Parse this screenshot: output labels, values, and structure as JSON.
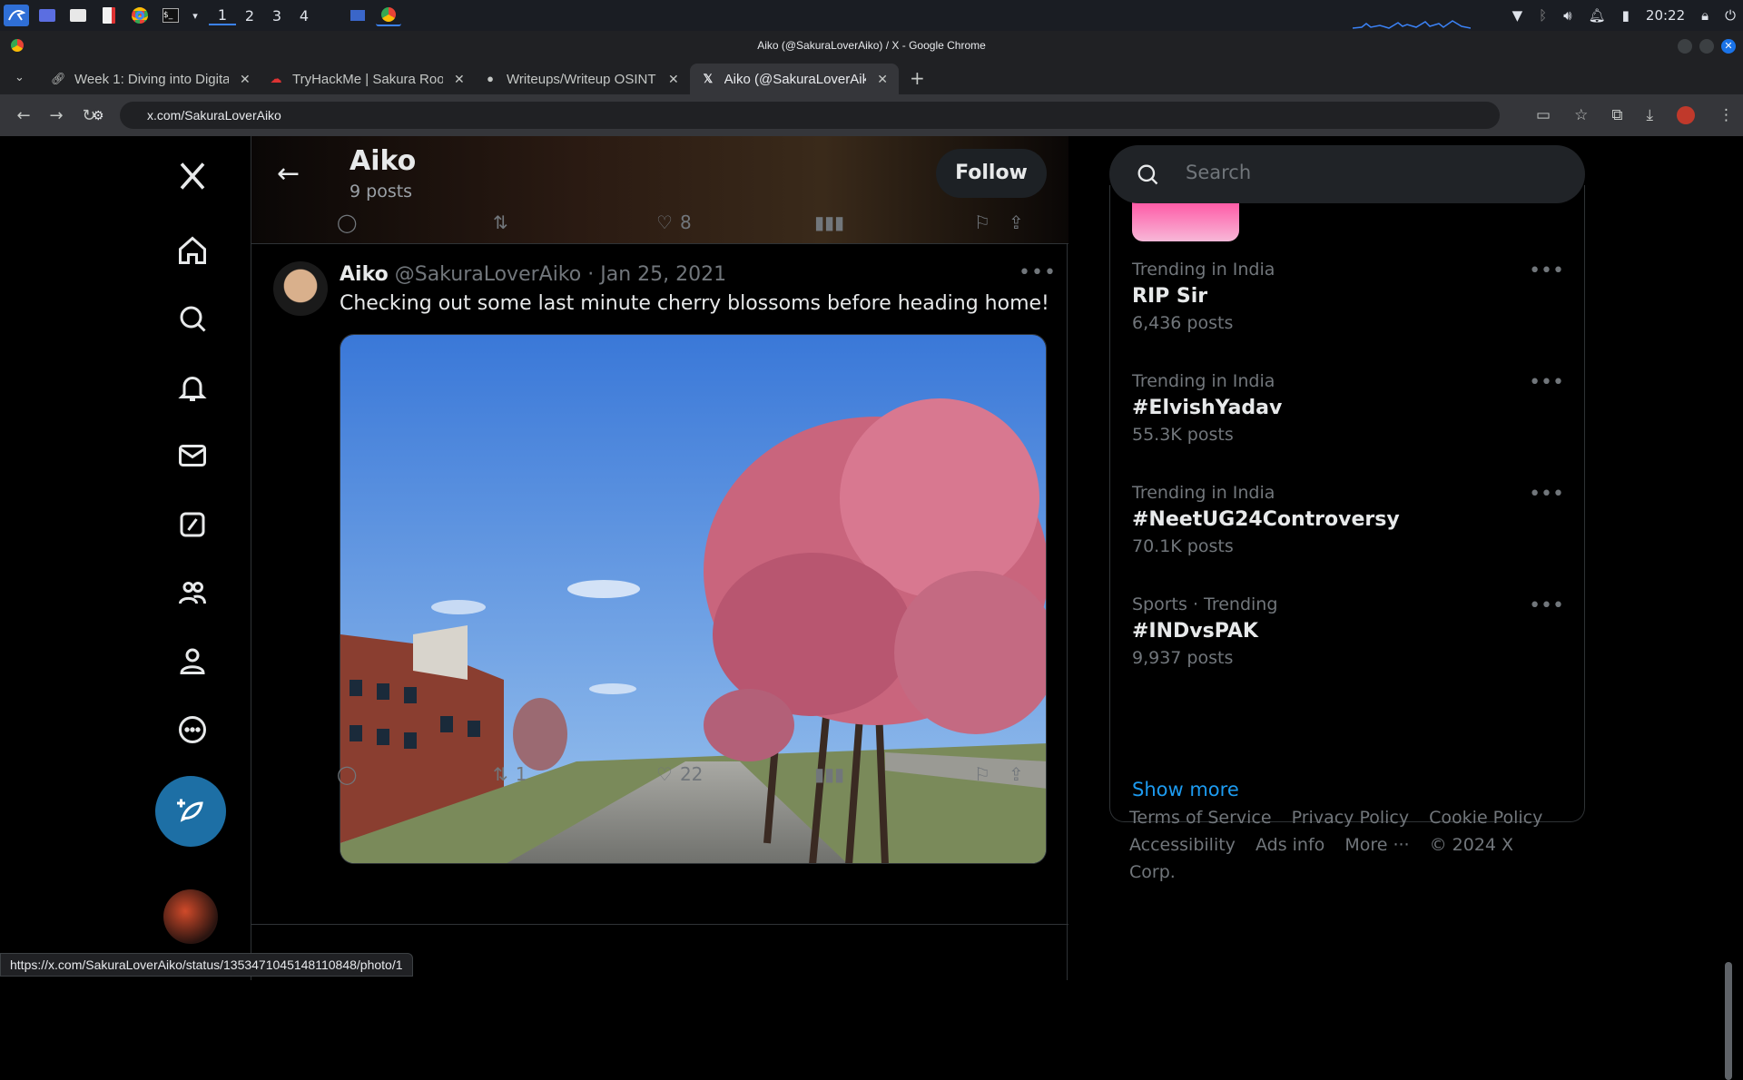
{
  "taskbar": {
    "workspaces": [
      "1",
      "2",
      "3",
      "4"
    ],
    "clock": "20:22"
  },
  "window": {
    "title": "Aiko (@SakuraLoverAiko) / X - Google Chrome"
  },
  "tabs": [
    {
      "label": "Week 1: Diving into Digita",
      "icon": "link-icon"
    },
    {
      "label": "TryHackMe | Sakura Room",
      "icon": "tryhackme-icon"
    },
    {
      "label": "Writeups/Writeup OSINT",
      "icon": "github-icon"
    },
    {
      "label": "Aiko (@SakuraLoverAiko)",
      "icon": "x-logo-icon"
    }
  ],
  "address": {
    "url": "x.com/SakuraLoverAiko"
  },
  "profile_header": {
    "name": "Aiko",
    "posts_count": "9 posts",
    "follow_label": "Follow"
  },
  "prev_tweet": {
    "likes": "8"
  },
  "tweet": {
    "name": "Aiko",
    "handle": "@SakuraLoverAiko",
    "separator": "·",
    "date": "Jan 25, 2021",
    "text": "Checking out some last minute cherry blossoms before heading home!",
    "retweets": "1",
    "likes": "22"
  },
  "search": {
    "placeholder": "Search"
  },
  "trends": [
    {
      "category": "Trending in India",
      "title": "RIP Sir",
      "count": "6,436 posts"
    },
    {
      "category": "Trending in India",
      "title": "#ElvishYadav",
      "count": "55.3K posts"
    },
    {
      "category": "Trending in India",
      "title": "#NeetUG24Controversy",
      "count": "70.1K posts"
    },
    {
      "category": "Sports · Trending",
      "title": "#INDvsPAK",
      "count": "9,937 posts"
    }
  ],
  "show_more": "Show more",
  "footer": {
    "links": [
      "Terms of Service",
      "Privacy Policy",
      "Cookie Policy",
      "Accessibility",
      "Ads info",
      "More ···"
    ],
    "copyright": "© 2024 X Corp."
  },
  "status_bar_url": "https://x.com/SakuraLoverAiko/status/1353471045148110848/photo/1",
  "colors": {
    "accent": "#1d9bf0",
    "post_button": "#1d6fa5",
    "background": "#000000"
  }
}
